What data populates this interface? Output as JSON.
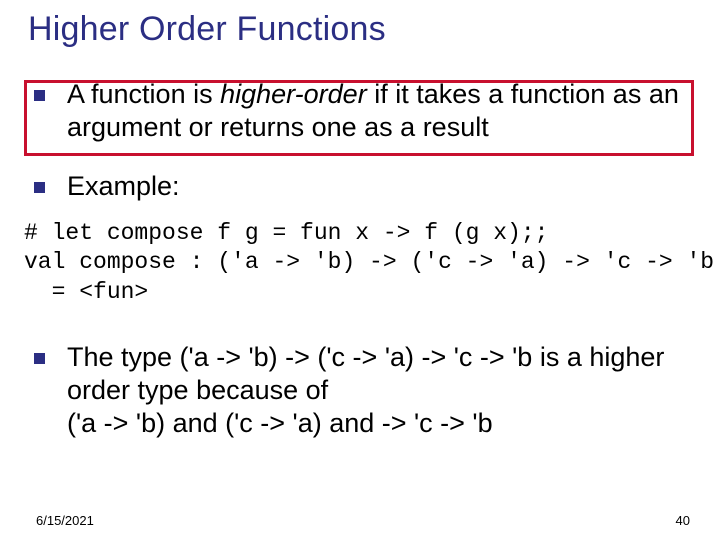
{
  "title": "Higher Order Functions",
  "bullets": {
    "b1_pre": "A function is ",
    "b1_em": "higher-order",
    "b1_post": " if it takes a function as an argument or returns one as a result",
    "b2": "Example:",
    "b3": "The type ('a -> 'b) -> ('c -> 'a) -> 'c -> 'b is a higher order type because of\n('a -> 'b) and  ('c -> 'a) and  -> 'c -> 'b"
  },
  "code": "# let compose f g = fun x -> f (g x);;\nval compose : ('a -> 'b) -> ('c -> 'a) -> 'c -> 'b\n  = <fun>",
  "footer": {
    "date": "6/15/2021",
    "page": "40"
  }
}
